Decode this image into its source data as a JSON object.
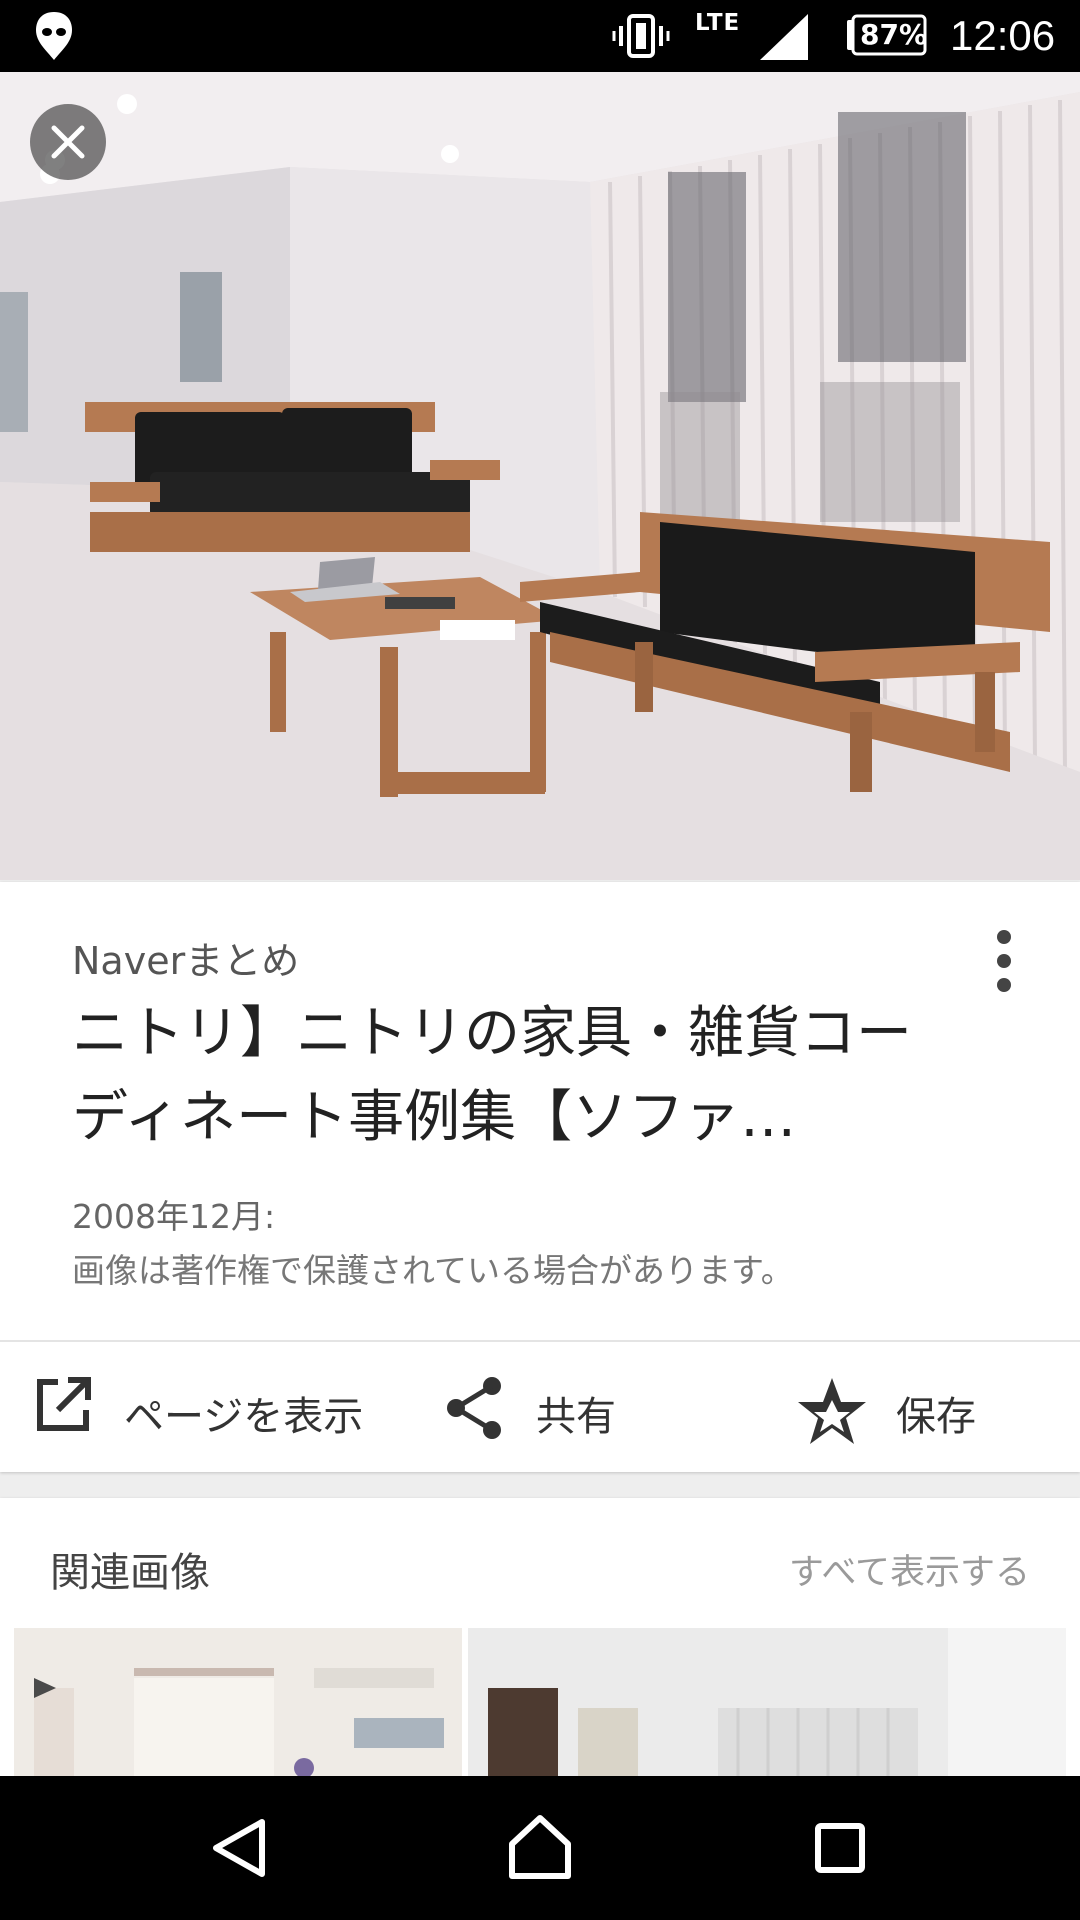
{
  "status_bar": {
    "network": "LTE",
    "battery": "87%",
    "time": "12:06",
    "icons": [
      "alien-icon",
      "vibrate-icon",
      "signal-icon",
      "battery-icon"
    ]
  },
  "image_viewer": {
    "close_icon": "close-icon"
  },
  "info": {
    "source": "Naverまとめ",
    "title": "ニトリ】ニトリの家具・雑貨コーディネート事例集【ソファ…",
    "date": "2008年12月:",
    "copyright_notice": "画像は著作権で保護されている場合があります。",
    "more_icon": "more-vertical-icon"
  },
  "actions": {
    "open_page": {
      "label": "ページを表示",
      "icon": "open-external-icon"
    },
    "share": {
      "label": "共有",
      "icon": "share-icon"
    },
    "save": {
      "label": "保存",
      "icon": "star-icon"
    }
  },
  "related": {
    "title": "関連画像",
    "view_all": "すべて表示する"
  },
  "nav": {
    "back_icon": "back-triangle-icon",
    "home_icon": "home-icon",
    "recents_icon": "recents-square-icon"
  },
  "colors": {
    "status_bar_bg": "#000000",
    "card_bg": "#ffffff",
    "sofa": "#1c1c1c",
    "wood": "#b57a52"
  }
}
